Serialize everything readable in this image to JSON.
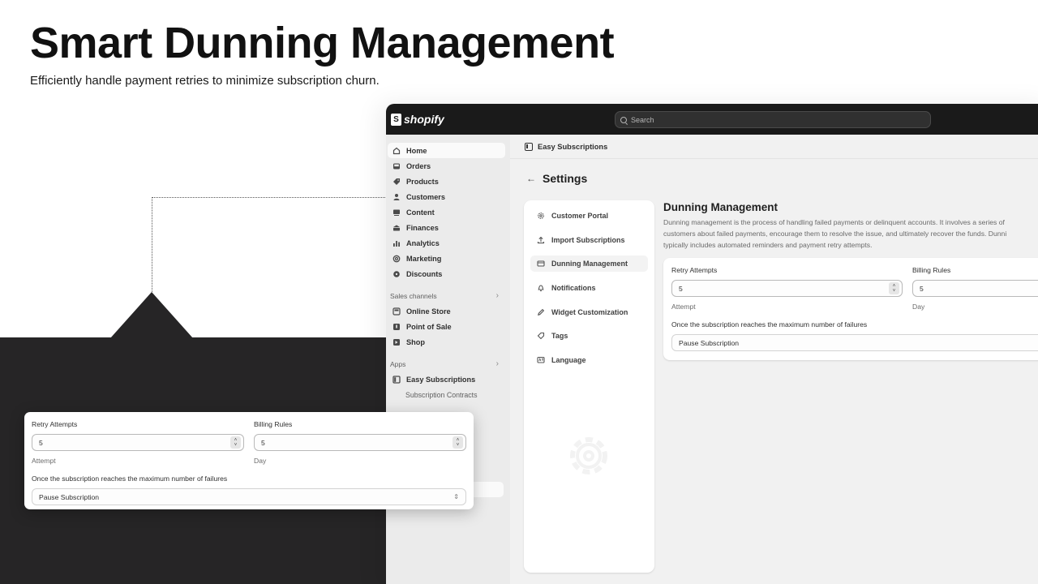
{
  "hero": {
    "title": "Smart Dunning Management",
    "subtitle": "Efficiently handle payment retries to minimize subscription churn."
  },
  "admin": {
    "brand": "shopify",
    "search_placeholder": "Search",
    "sidebar": {
      "items": [
        {
          "label": "Home",
          "icon": "home-icon",
          "active": true
        },
        {
          "label": "Orders",
          "icon": "inbox-icon"
        },
        {
          "label": "Products",
          "icon": "tag-icon"
        },
        {
          "label": "Customers",
          "icon": "person-icon"
        },
        {
          "label": "Content",
          "icon": "content-icon"
        },
        {
          "label": "Finances",
          "icon": "bank-icon"
        },
        {
          "label": "Analytics",
          "icon": "bar-chart-icon"
        },
        {
          "label": "Marketing",
          "icon": "target-icon"
        },
        {
          "label": "Discounts",
          "icon": "discount-icon"
        }
      ],
      "sales_channels_label": "Sales channels",
      "sales_channels": [
        {
          "label": "Online Store",
          "icon": "store-icon"
        },
        {
          "label": "Point of Sale",
          "icon": "pos-icon"
        },
        {
          "label": "Shop",
          "icon": "shop-icon"
        }
      ],
      "apps_label": "Apps",
      "apps": [
        {
          "label": "Easy Subscriptions",
          "icon": "app-icon"
        }
      ],
      "app_subitems": [
        "Subscription Contracts"
      ]
    },
    "app_header": "Easy Subscriptions",
    "page_title": "Settings",
    "settings_menu": [
      {
        "label": "Customer Portal",
        "icon": "gear-icon"
      },
      {
        "label": "Import Subscriptions",
        "icon": "upload-icon"
      },
      {
        "label": "Dunning Management",
        "icon": "credit-card-icon",
        "active": true
      },
      {
        "label": "Notifications",
        "icon": "bell-icon"
      },
      {
        "label": "Widget Customization",
        "icon": "pencil-icon"
      },
      {
        "label": "Tags",
        "icon": "tag-icon"
      },
      {
        "label": "Language",
        "icon": "language-icon"
      }
    ],
    "dunning": {
      "title": "Dunning Management",
      "description_lines": [
        "Dunning management is the process of handling failed payments or delinquent accounts. It involves a series of",
        "customers about failed payments, encourage them to resolve the issue, and ultimately recover the funds. Dunni",
        "typically includes automated reminders and payment retry attempts."
      ]
    }
  },
  "form": {
    "retry_label": "Retry Attempts",
    "retry_value": "5",
    "retry_help": "Attempt",
    "billing_label": "Billing Rules",
    "billing_value": "5",
    "billing_help": "Day",
    "failure_label": "Once the subscription reaches the maximum number of failures",
    "failure_action": "Pause Subscription"
  }
}
